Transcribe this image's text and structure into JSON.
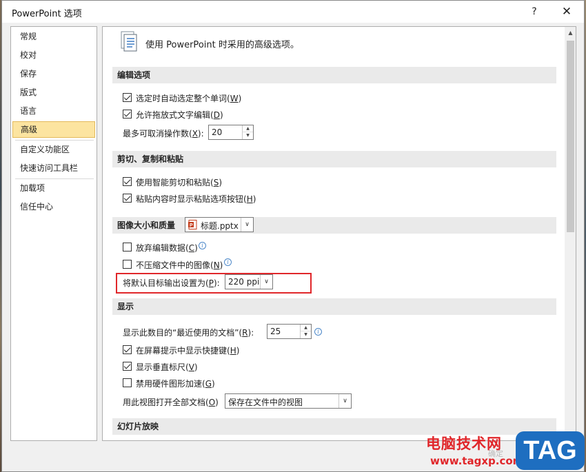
{
  "window": {
    "title": "PowerPoint 选项",
    "help_label": "?",
    "close_label": "✕"
  },
  "nav": {
    "items": [
      {
        "label": "常规"
      },
      {
        "label": "校对"
      },
      {
        "label": "保存"
      },
      {
        "label": "版式"
      },
      {
        "label": "语言"
      },
      {
        "label": "高级",
        "selected": true
      },
      {
        "label": "自定义功能区"
      },
      {
        "label": "快速访问工具栏"
      },
      {
        "label": "加载项"
      },
      {
        "label": "信任中心"
      }
    ]
  },
  "content": {
    "header_text": "使用 PowerPoint 时采用的高级选项。",
    "sections": {
      "editing": "编辑选项",
      "clipboard": "剪切、复制和粘贴",
      "image": "图像大小和质量",
      "display": "显示",
      "slideshow": "幻灯片放映"
    },
    "editing": {
      "select_whole_word": {
        "label": "选定时自动选定整个单词(",
        "key": "W",
        "tail": ")",
        "checked": true
      },
      "drag_drop": {
        "label": "允许拖放式文字编辑(",
        "key": "D",
        "tail": ")",
        "checked": true
      },
      "max_undo_label": "最多可取消操作数(",
      "max_undo_key": "X",
      "max_undo_tail": "):",
      "max_undo_value": "20"
    },
    "clipboard": {
      "smart_cut": {
        "label": "使用智能剪切和粘贴(",
        "key": "S",
        "tail": ")",
        "checked": true
      },
      "paste_options": {
        "label": "粘贴内容时显示粘贴选项按钮(",
        "key": "H",
        "tail": ")",
        "checked": true
      }
    },
    "image": {
      "file_name": "标题.pptx",
      "discard_edit": {
        "label": "放弃编辑数据(",
        "key": "C",
        "tail": ")",
        "checked": false
      },
      "no_compress": {
        "label": "不压缩文件中的图像(",
        "key": "N",
        "tail": ")",
        "checked": false
      },
      "default_output_label": "将默认目标输出设置为(",
      "default_output_key": "P",
      "default_output_tail": "):",
      "default_output_value": "220 ppi"
    },
    "display": {
      "recent_docs_label": "显示此数目的“最近使用的文档”(",
      "recent_docs_key": "R",
      "recent_docs_tail": "):",
      "recent_docs_value": "25",
      "show_shortcut_keys": {
        "label": "在屏幕提示中显示快捷键(",
        "key": "H",
        "tail": ")",
        "checked": true
      },
      "vertical_ruler": {
        "label": "显示垂直标尺(",
        "key": "V",
        "tail": ")",
        "checked": true
      },
      "disable_hw_accel": {
        "label": "禁用硬件图形加速(",
        "key": "G",
        "tail": ")",
        "checked": false
      },
      "open_view_label": "用此视图打开全部文档(",
      "open_view_key": "O",
      "open_view_tail": ")",
      "open_view_value": "保存在文件中的视图"
    }
  },
  "footer": {
    "ok_label": "确定"
  },
  "watermark": {
    "cn": "电脑技术网",
    "url": "www.tagxp.com",
    "tag": "TAG"
  },
  "colors": {
    "selected_nav_bg": "#fce4a0",
    "highlight_border": "#e0262a",
    "watermark_red": "#e0262a",
    "watermark_blue": "#1e6ec0"
  }
}
